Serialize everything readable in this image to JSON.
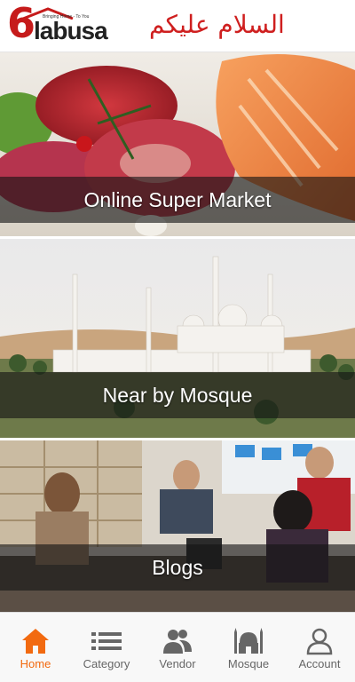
{
  "header": {
    "logo_number": "6",
    "logo_word": "labusa",
    "logo_tagline": "Bringing Home - To You",
    "greeting": "السلام عليكم"
  },
  "banners": [
    {
      "caption": "Online Super Market"
    },
    {
      "caption": "Near by Mosque"
    },
    {
      "caption": "Blogs"
    }
  ],
  "bottom_nav": {
    "active": "Home",
    "items": [
      {
        "label": "Home",
        "icon": "home-icon"
      },
      {
        "label": "Category",
        "icon": "list-icon"
      },
      {
        "label": "Vendor",
        "icon": "users-icon"
      },
      {
        "label": "Mosque",
        "icon": "mosque-icon"
      },
      {
        "label": "Account",
        "icon": "user-icon"
      }
    ]
  },
  "colors": {
    "brand_red": "#c61b1b",
    "active_orange": "#f26a10",
    "nav_grey": "#666666"
  }
}
